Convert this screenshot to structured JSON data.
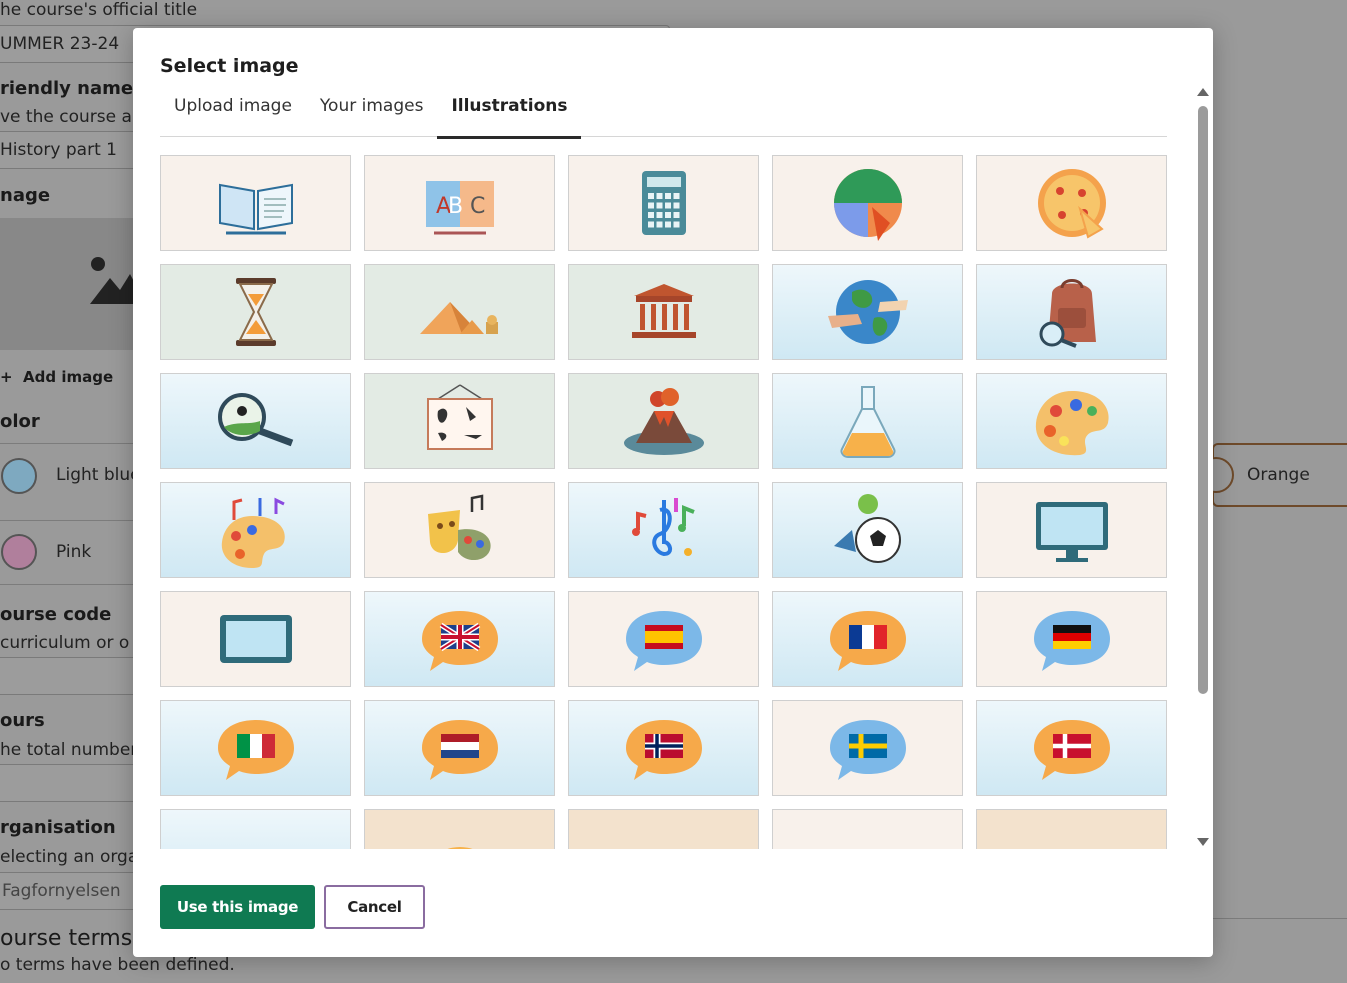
{
  "background": {
    "title_hint": "he course's official title",
    "title_value": "UMMER 23-24",
    "friendly_label": "riendly name",
    "friendly_hint": "ve the course a",
    "friendly_value": "History part 1",
    "image_label": "nage",
    "add_image": "Add image",
    "color_label": "olor",
    "colors": [
      {
        "label": "Light blue",
        "hex": "#7ea9c0"
      },
      {
        "label": "Pink",
        "hex": "#b07f9c"
      },
      {
        "label": "Orange",
        "hex": "#c9834a"
      }
    ],
    "code_label": "ourse code",
    "code_hint": "curriculum or o",
    "hours_label": "ours",
    "hours_hint": "he total number",
    "org_label": "rganisation",
    "org_hint": "electing an orga",
    "org_value": "Fagfornyelsen",
    "terms_label": "ourse terms",
    "terms_hint": "o terms have been defined."
  },
  "dialog": {
    "title": "Select image",
    "tabs": [
      {
        "label": "Upload image",
        "active": false
      },
      {
        "label": "Your images",
        "active": false
      },
      {
        "label": "Illustrations",
        "active": true
      }
    ],
    "tiles": [
      {
        "icon": "open-book-icon",
        "bg": "cream"
      },
      {
        "icon": "abc-book-icon",
        "bg": "cream"
      },
      {
        "icon": "calculator-icon",
        "bg": "cream"
      },
      {
        "icon": "pie-chart-icon",
        "bg": "cream"
      },
      {
        "icon": "pizza-fractions-icon",
        "bg": "cream"
      },
      {
        "icon": "hourglass-icon",
        "bg": "sage"
      },
      {
        "icon": "pyramids-icon",
        "bg": "sage"
      },
      {
        "icon": "greek-temple-icon",
        "bg": "sage"
      },
      {
        "icon": "globe-hands-icon",
        "bg": "sky"
      },
      {
        "icon": "backpack-magnifier-icon",
        "bg": "sky"
      },
      {
        "icon": "magnifier-ant-icon",
        "bg": "sky"
      },
      {
        "icon": "biology-chart-icon",
        "bg": "sage"
      },
      {
        "icon": "volcano-icon",
        "bg": "sage"
      },
      {
        "icon": "flask-icon",
        "bg": "sky"
      },
      {
        "icon": "paint-palette-icon",
        "bg": "sky"
      },
      {
        "icon": "palette-music-icon",
        "bg": "sky"
      },
      {
        "icon": "theater-masks-icon",
        "bg": "cream"
      },
      {
        "icon": "music-notes-icon",
        "bg": "sky"
      },
      {
        "icon": "sports-balls-icon",
        "bg": "sky"
      },
      {
        "icon": "monitor-icon",
        "bg": "cream"
      },
      {
        "icon": "tablet-icon",
        "bg": "cream"
      },
      {
        "icon": "uk-flag-bubble-icon",
        "bg": "sky"
      },
      {
        "icon": "spain-flag-bubble-icon",
        "bg": "cream"
      },
      {
        "icon": "france-flag-bubble-icon",
        "bg": "sky"
      },
      {
        "icon": "germany-flag-bubble-icon",
        "bg": "cream"
      },
      {
        "icon": "italy-flag-bubble-icon",
        "bg": "sky"
      },
      {
        "icon": "netherlands-flag-bubble-icon",
        "bg": "sky"
      },
      {
        "icon": "norway-flag-bubble-icon",
        "bg": "sky"
      },
      {
        "icon": "sweden-flag-bubble-icon",
        "bg": "cream"
      },
      {
        "icon": "denmark-flag-bubble-icon",
        "bg": "sky"
      },
      {
        "icon": "numbers-tree-icon",
        "bg": "sky"
      },
      {
        "icon": "sun-icon",
        "bg": "peach"
      },
      {
        "icon": "notepad-icon",
        "bg": "peach"
      },
      {
        "icon": "smiley-icon",
        "bg": "cream"
      },
      {
        "icon": "graduation-cap-icon",
        "bg": "peach"
      }
    ],
    "use_button": "Use this image",
    "cancel_button": "Cancel"
  }
}
